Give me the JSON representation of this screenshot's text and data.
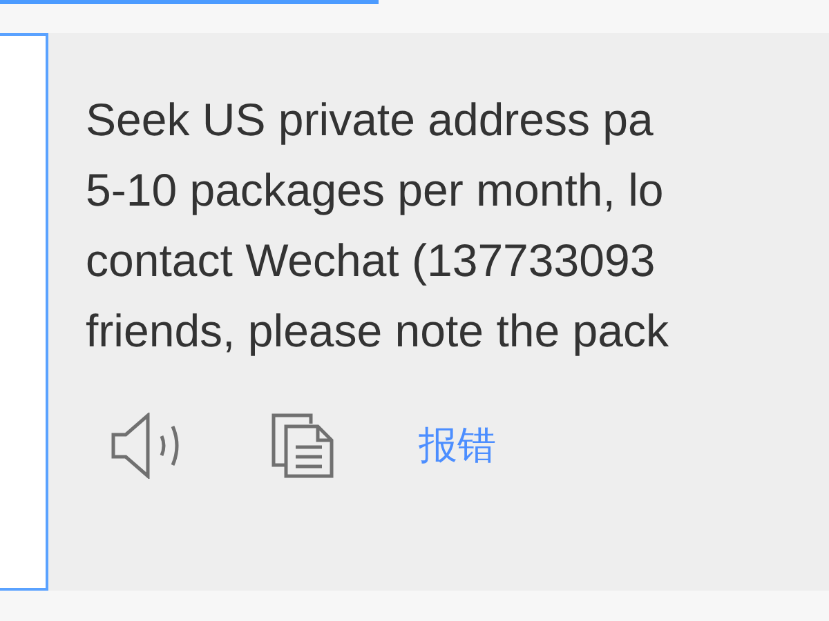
{
  "translation": {
    "lines": [
      "Seek US private address pa",
      "5-10 packages per month, lo",
      "contact Wechat (137733093",
      "friends, please note the pack"
    ]
  },
  "actions": {
    "report_link": "报错"
  }
}
